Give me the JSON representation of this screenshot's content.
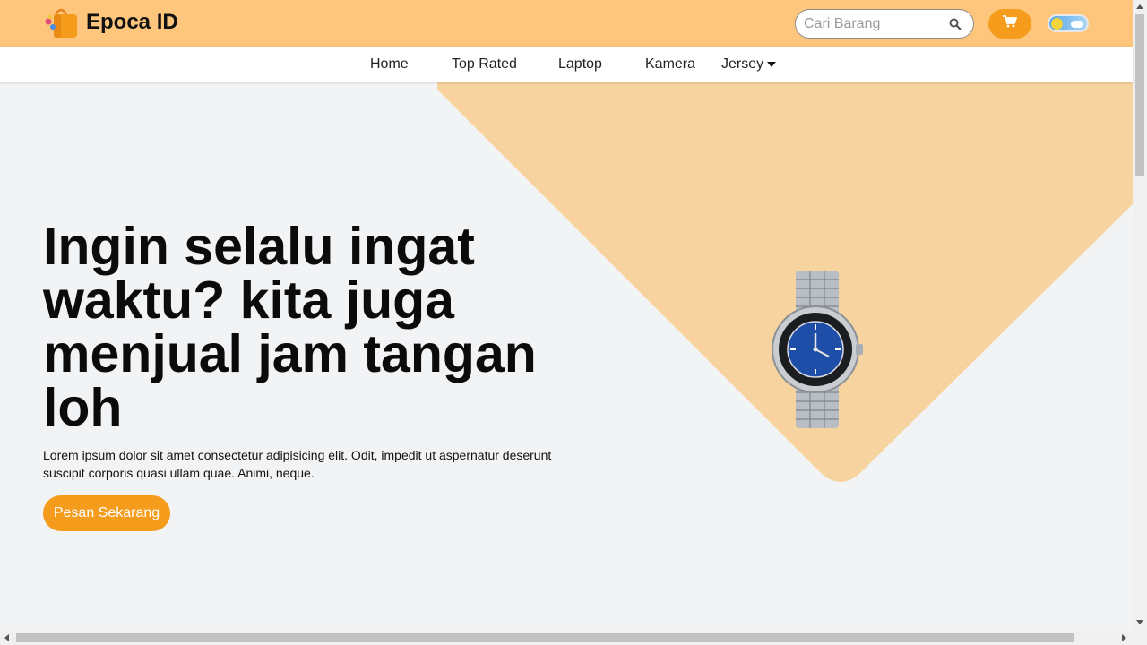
{
  "header": {
    "brand": "Epoca ID",
    "search_placeholder": "Cari Barang",
    "accent": "#fec57c",
    "button_color": "#f59c1c",
    "logo_icon": "shopping-bag-icon",
    "search_icon": "search-icon",
    "cart_icon": "cart-icon",
    "theme_toggle_icon": "day-night-toggle-icon"
  },
  "nav": {
    "items": [
      {
        "label": "Home"
      },
      {
        "label": "Top Rated"
      },
      {
        "label": "Laptop"
      },
      {
        "label": "Kamera"
      },
      {
        "label": "Jersey",
        "dropdown": true
      }
    ]
  },
  "hero": {
    "title": "Ingin selalu ingat waktu? kita juga menjual jam tangan loh",
    "description": "Lorem ipsum dolor sit amet consectetur adipisicing elit. Odit, impedit ut aspernatur deserunt suscipit corporis quasi ullam quae. Animi, neque.",
    "cta_label": "Pesan Sekarang",
    "image": "wristwatch-image",
    "background_shape_color": "#f7d49f"
  }
}
